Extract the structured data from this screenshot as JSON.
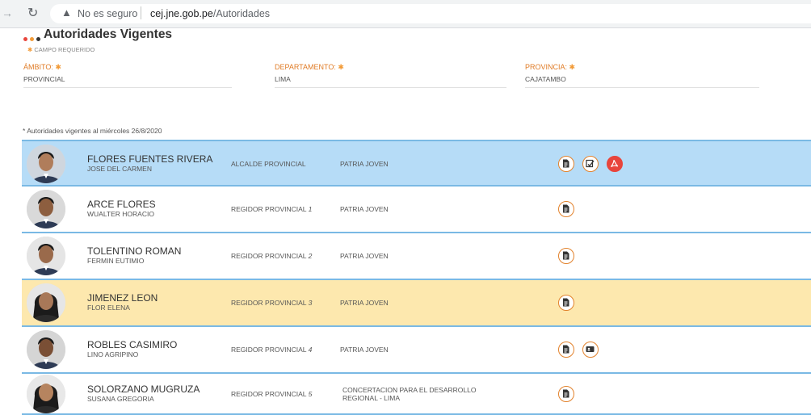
{
  "browser": {
    "insecure_label": "No es seguro",
    "host": "cej.jne.gob.pe",
    "path": "/Autoridades"
  },
  "page": {
    "title": "Autoridades Vigentes",
    "required_note": "CAMPO REQUERIDO",
    "dot_colors": [
      "#e8453c",
      "#f29b38",
      "#333333"
    ],
    "accent": "#e07b25",
    "fields": {
      "ambito": {
        "label": "ÁMBITO:",
        "value": "PROVINCIAL"
      },
      "departamento": {
        "label": "DEPARTAMENTO:",
        "value": "LIMA"
      },
      "provincia": {
        "label": "PROVINCIA:",
        "value": "CAJATAMBO"
      }
    },
    "validity_note": "* Autoridades vigentes al miércoles 26/8/2020"
  },
  "authorities": [
    {
      "surname": "FLORES FUENTES RIVERA",
      "given": "JOSE DEL CARMEN",
      "cargo": "ALCALDE PROVINCIAL",
      "cargo_num": "",
      "org": "PATRIA JOVEN",
      "org_line2": "",
      "highlight": "blue",
      "icons": [
        "document-icon",
        "signed-document-icon",
        "pdf-icon"
      ]
    },
    {
      "surname": "ARCE FLORES",
      "given": "WUALTER HORACIO",
      "cargo": "REGIDOR PROVINCIAL",
      "cargo_num": "1",
      "org": "PATRIA JOVEN",
      "org_line2": "",
      "highlight": "white",
      "icons": [
        "document-icon"
      ]
    },
    {
      "surname": "TOLENTINO ROMAN",
      "given": "FERMIN EUTIMIO",
      "cargo": "REGIDOR PROVINCIAL",
      "cargo_num": "2",
      "org": "PATRIA JOVEN",
      "org_line2": "",
      "highlight": "white",
      "icons": [
        "document-icon"
      ]
    },
    {
      "surname": "JIMENEZ LEON",
      "given": "FLOR ELENA",
      "cargo": "REGIDOR PROVINCIAL",
      "cargo_num": "3",
      "org": "PATRIA JOVEN",
      "org_line2": "",
      "highlight": "yellow",
      "icons": [
        "document-icon"
      ]
    },
    {
      "surname": "ROBLES CASIMIRO",
      "given": "LINO AGRIPINO",
      "cargo": "REGIDOR PROVINCIAL",
      "cargo_num": "4",
      "org": "PATRIA JOVEN",
      "org_line2": "",
      "highlight": "white",
      "icons": [
        "document-icon",
        "id-card-icon"
      ]
    },
    {
      "surname": "SOLORZANO MUGRUZA",
      "given": "SUSANA GREGORIA",
      "cargo": "REGIDOR PROVINCIAL",
      "cargo_num": "5",
      "org": "CONCERTACION PARA EL DESARROLLO",
      "org_line2": "REGIONAL - LIMA",
      "highlight": "white",
      "icons": [
        "document-icon"
      ]
    }
  ]
}
